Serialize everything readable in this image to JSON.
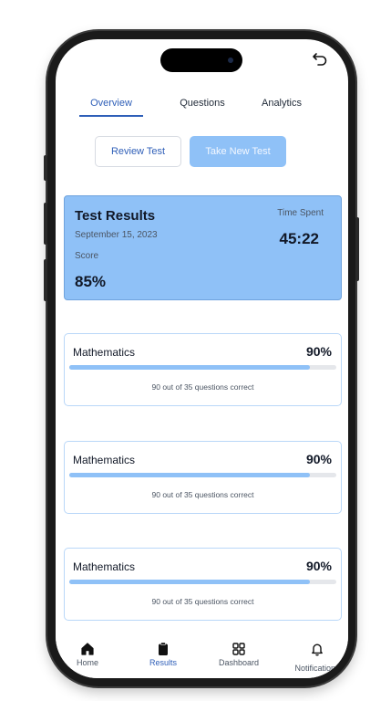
{
  "tabs": [
    {
      "label": "Overview",
      "active": true
    },
    {
      "label": "Questions",
      "active": false
    },
    {
      "label": "Analytics",
      "active": false
    }
  ],
  "actions": {
    "review_label": "Review Test",
    "new_test_label": "Take New Test"
  },
  "results": {
    "title": "Test Results",
    "date": "September 15, 2023",
    "score_label": "Score",
    "score": "85%",
    "time_label": "Time Spent",
    "time": "45:22"
  },
  "subjects": [
    {
      "name": "Mathematics",
      "percent": "90%",
      "progress": 0.9,
      "detail": "90 out of 35 questions correct"
    },
    {
      "name": "Mathematics",
      "percent": "90%",
      "progress": 0.9,
      "detail": "90 out of 35 questions correct"
    },
    {
      "name": "Mathematics",
      "percent": "90%",
      "progress": 0.9,
      "detail": "90 out of 35 questions correct"
    }
  ],
  "nav": [
    {
      "label": "Home",
      "icon": "home-icon",
      "active": false
    },
    {
      "label": "Results",
      "icon": "clipboard-icon",
      "active": true
    },
    {
      "label": "Dashboard",
      "icon": "grid-icon",
      "active": false
    },
    {
      "label": "Notifications",
      "icon": "bell-icon",
      "active": false
    }
  ],
  "colors": {
    "accent": "#2f5fb8",
    "card_blue": "#8fc1f7",
    "card_border": "#b9d7f8"
  }
}
